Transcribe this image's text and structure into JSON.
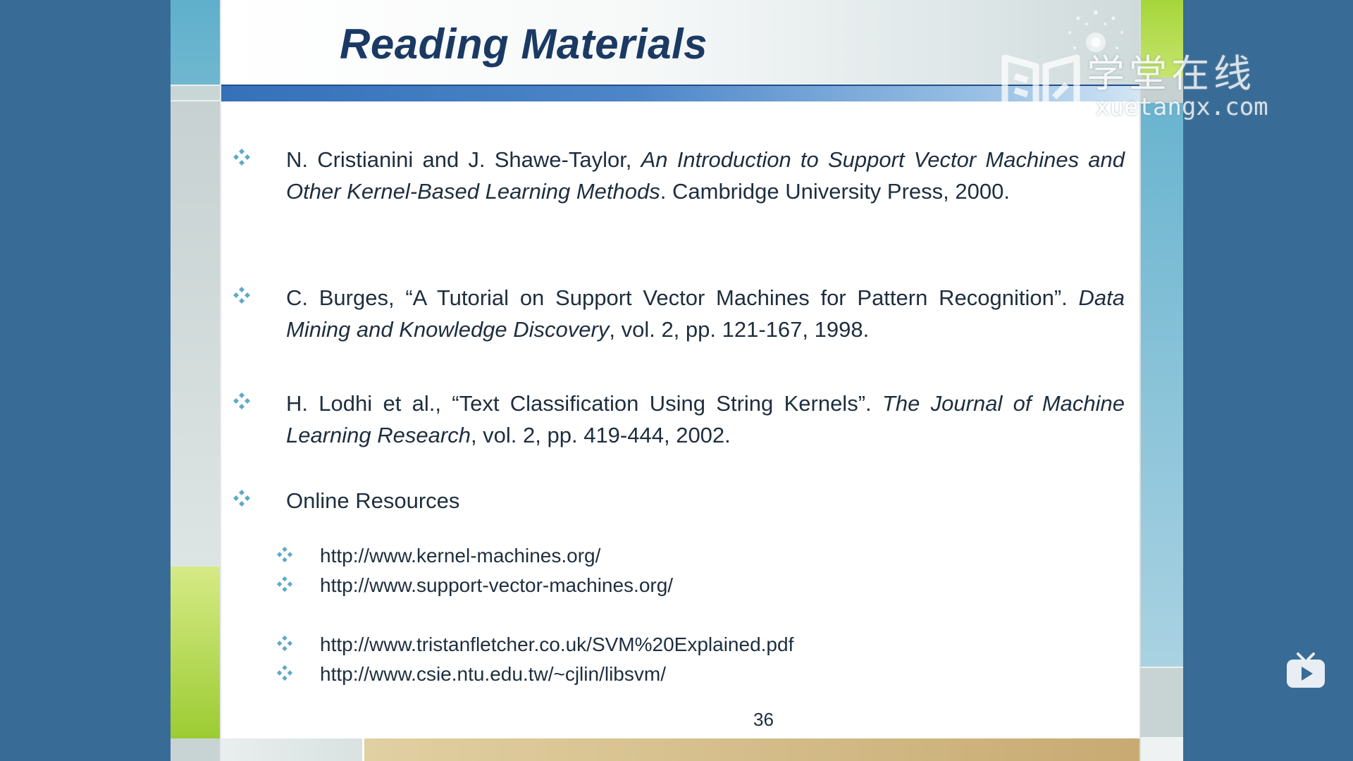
{
  "slide": {
    "title": "Reading Materials",
    "page_number": "36",
    "references": [
      {
        "plain_a": "N. Cristianini and J. Shawe-Taylor, ",
        "italic": "An Introduction to Support Vector Machines and Other Kernel-Based Learning Methods",
        "plain_b": ". Cambridge University Press, 2000."
      },
      {
        "plain_a": "C. Burges, “A Tutorial on Support Vector Machines for Pattern Recognition”. ",
        "italic": "Data Mining and Knowledge Discovery",
        "plain_b": ", vol. 2, pp. 121-167, 1998."
      },
      {
        "plain_a": "H. Lodhi et al., “Text Classification Using String Kernels”. ",
        "italic": "The Journal of Machine Learning Research",
        "plain_b": ", vol. 2, pp. 419-444, 2002."
      }
    ],
    "online_resources": {
      "label": "Online Resources",
      "links": [
        "http://www.kernel-machines.org/",
        "http://www.support-vector-machines.org/",
        "http://www.tristanfletcher.co.uk/SVM%20Explained.pdf",
        "http://www.csie.ntu.edu.tw/~cjlin/libsvm/"
      ]
    }
  },
  "watermark": {
    "chinese": "学堂在线",
    "domain": "xuetangx.com",
    "icon": "open-book-logo-icon"
  },
  "player": {
    "icon": "play-tv-icon"
  },
  "colors": {
    "background": "#386c97",
    "title": "#1b3a63",
    "text": "#1e2e3e",
    "bullet": "#5ea9c8",
    "title_bar": "#3570b9",
    "accent_green": "#9ccc33"
  }
}
